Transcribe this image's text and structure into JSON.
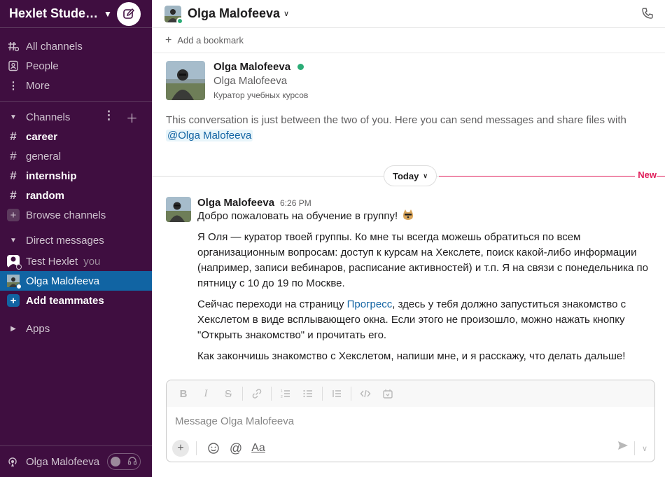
{
  "workspace": {
    "name": "Hexlet Stude…"
  },
  "nav": {
    "all_channels": "All channels",
    "people": "People",
    "more": "More"
  },
  "channels": {
    "section_label": "Channels",
    "items": [
      {
        "name": "career",
        "unread": true
      },
      {
        "name": "general",
        "unread": false
      },
      {
        "name": "internship",
        "unread": true
      },
      {
        "name": "random",
        "unread": true
      }
    ],
    "browse_label": "Browse channels"
  },
  "direct_messages": {
    "section_label": "Direct messages",
    "items": [
      {
        "name": "Test Hexlet",
        "suffix": "you",
        "active": false
      },
      {
        "name": "Olga Malofeeva",
        "active": true
      }
    ],
    "add_label": "Add teammates"
  },
  "apps": {
    "section_label": "Apps"
  },
  "footer": {
    "user_name": "Olga Malofeeva"
  },
  "header": {
    "title": "Olga Malofeeva",
    "bookmark_label": "Add a bookmark"
  },
  "intro": {
    "name": "Olga Malofeeva",
    "display_name": "Olga Malofeeva",
    "role": "Куратор учебных курсов",
    "text": "This conversation is just between the two of you. Here you can send messages and share files with",
    "mention": "@Olga Malofeeva"
  },
  "divider": {
    "today": "Today",
    "new_label": "New"
  },
  "message": {
    "author": "Olga Malofeeva",
    "time": "6:26 PM",
    "p1": "Добро пожаловать на обучение в группу!",
    "p2": "Я Оля — куратор твоей группы. Ко мне ты всегда можешь обратиться по всем организационным вопросам: доступ к курсам на Хекслете, поиск какой-либо информации (например, записи вебинаров, расписание активностей) и т.п. Я на связи с понедельника по пятницу с 10 до 19 по Москве.",
    "p3_before": "Сейчас переходи на страницу ",
    "p3_link": "Прогресс",
    "p3_after": ", здесь у тебя должно запуститься знакомство с Хекслетом в виде всплывающего окна. Если этого не произошло, можно нажать кнопку \"Открыть знакомство\" и прочитать его.",
    "p4": "Как закончишь знакомство с Хекслетом, напиши мне, и я расскажу, что делать дальше!"
  },
  "composer": {
    "placeholder": "Message Olga Malofeeva",
    "format_label": "Aa"
  },
  "colors": {
    "sidebar_bg": "#3f0e40",
    "active_bg": "#1164a3",
    "online": "#2bac76",
    "new_line": "#e01e5a",
    "link": "#1264a3"
  }
}
